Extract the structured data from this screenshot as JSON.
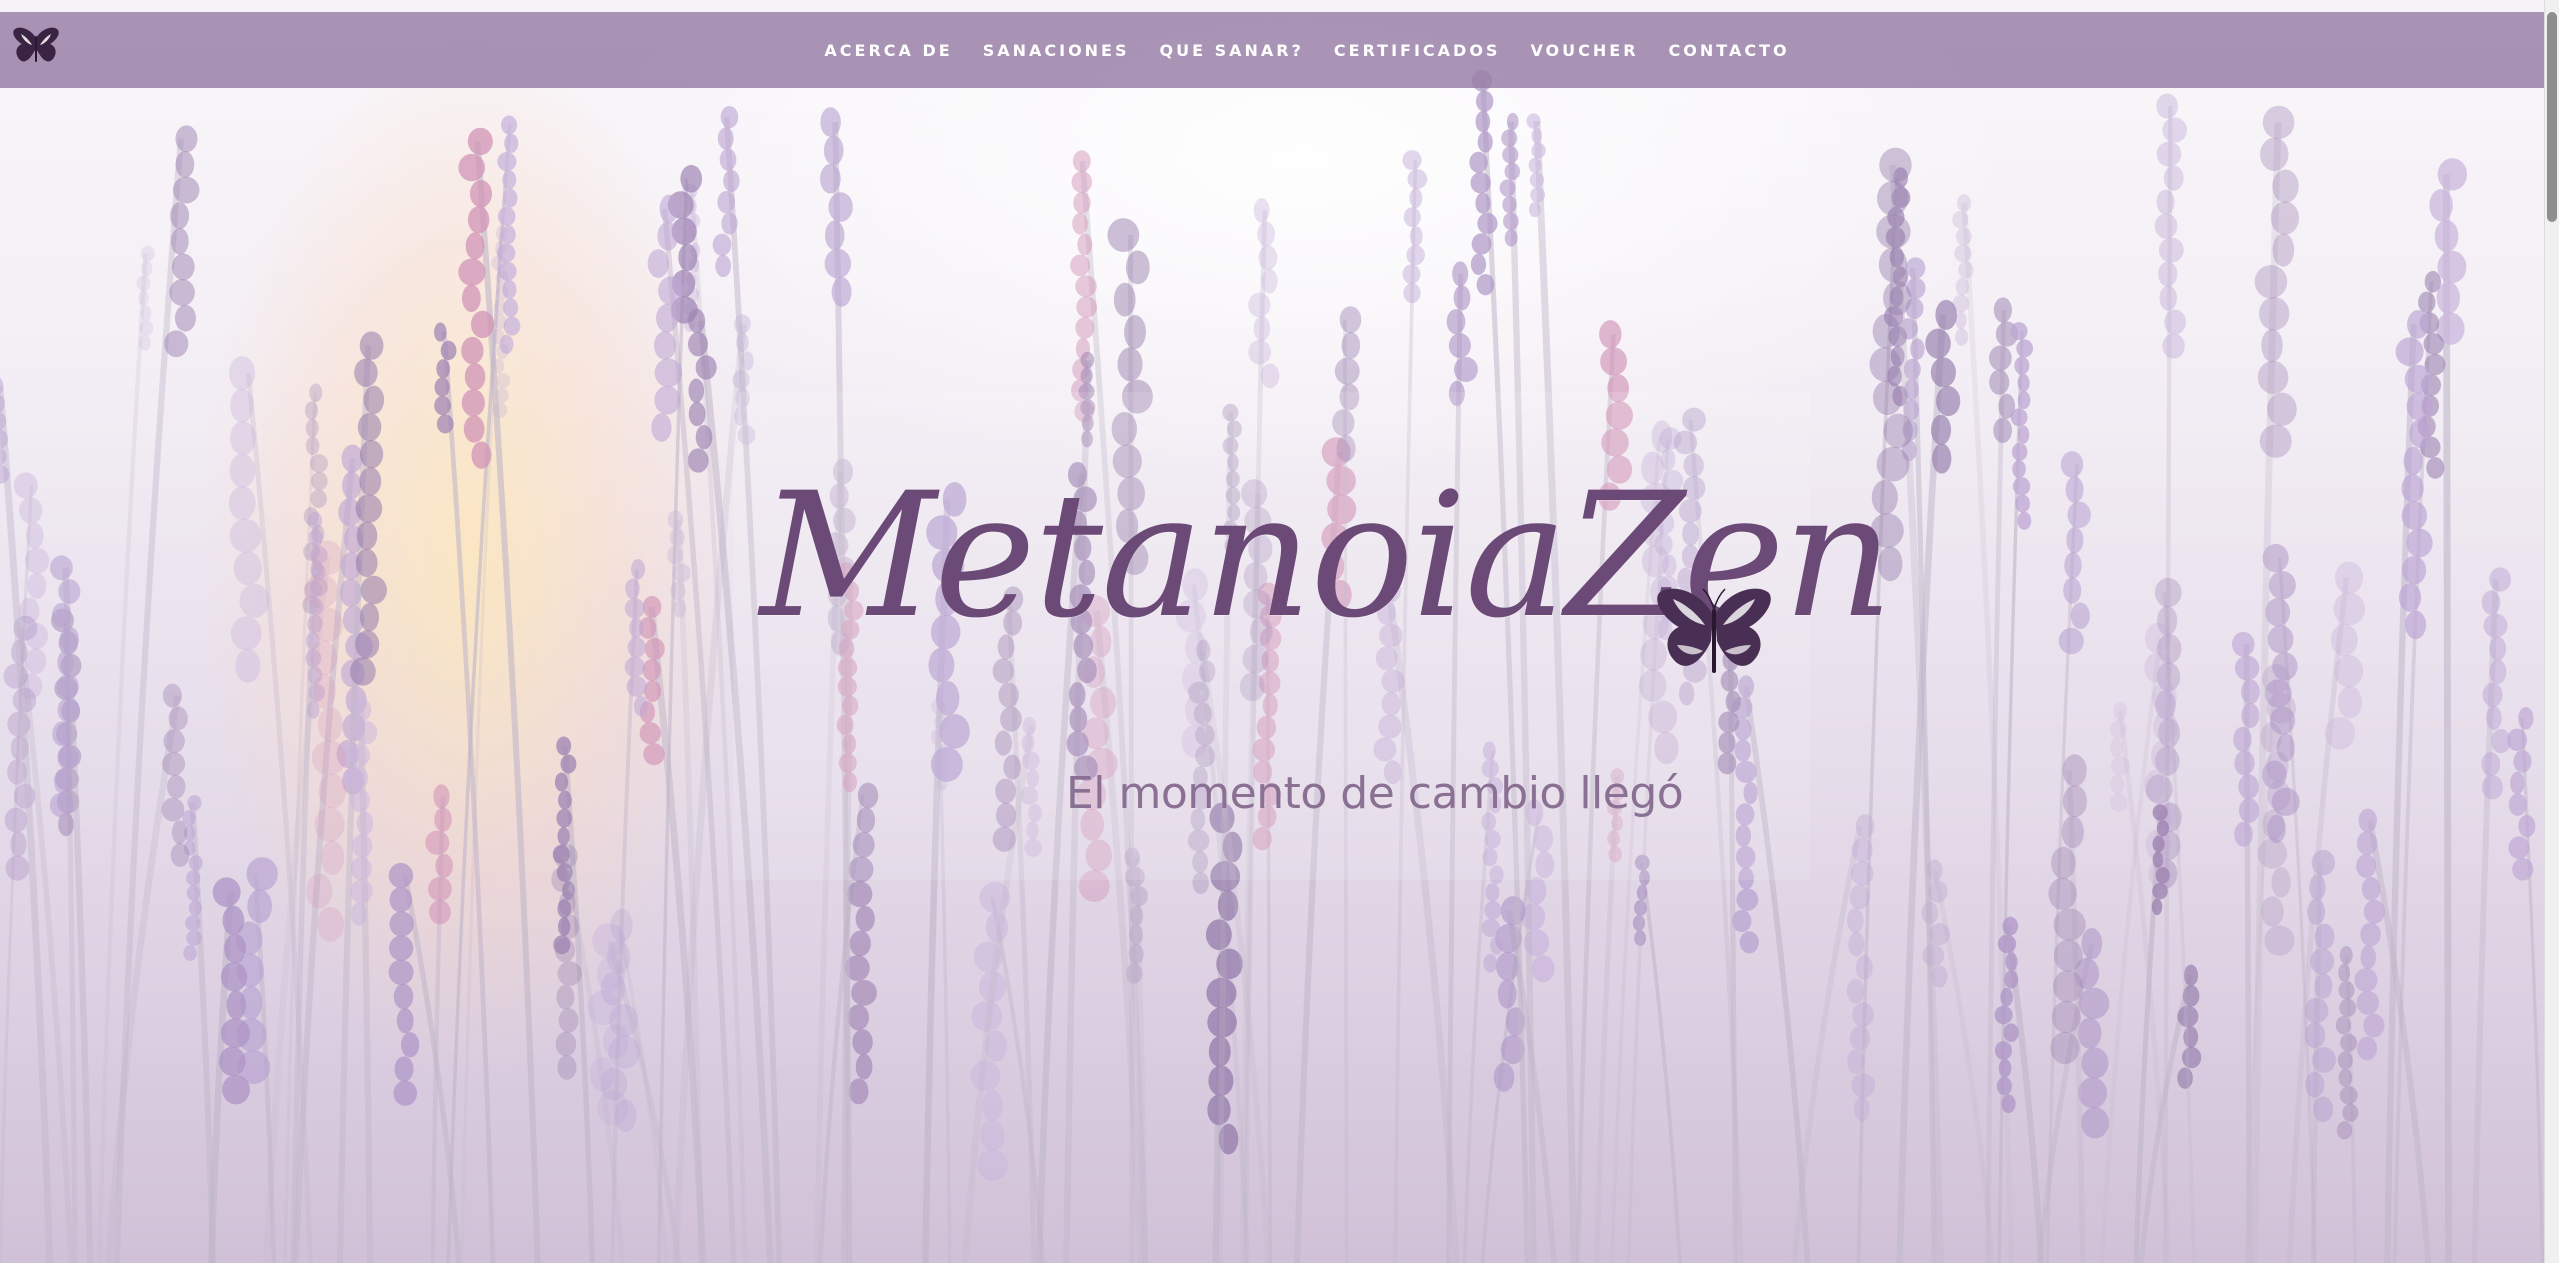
{
  "navbar": {
    "logo_icon": "butterfly-icon",
    "items": [
      {
        "label": "ACERCA DE"
      },
      {
        "label": "SANACIONES"
      },
      {
        "label": "QUE SANAR?"
      },
      {
        "label": "CERTIFICADOS"
      },
      {
        "label": "VOUCHER"
      },
      {
        "label": "CONTACTO"
      }
    ]
  },
  "hero": {
    "title": "MetanoiaZen",
    "title_icon": "butterfly-icon",
    "tagline": "El momento de cambio llegó"
  },
  "colors": {
    "navbar": "#967da5",
    "title": "#6c4a78",
    "tagline": "#8a7193",
    "lavender": "#9b7bb5"
  }
}
